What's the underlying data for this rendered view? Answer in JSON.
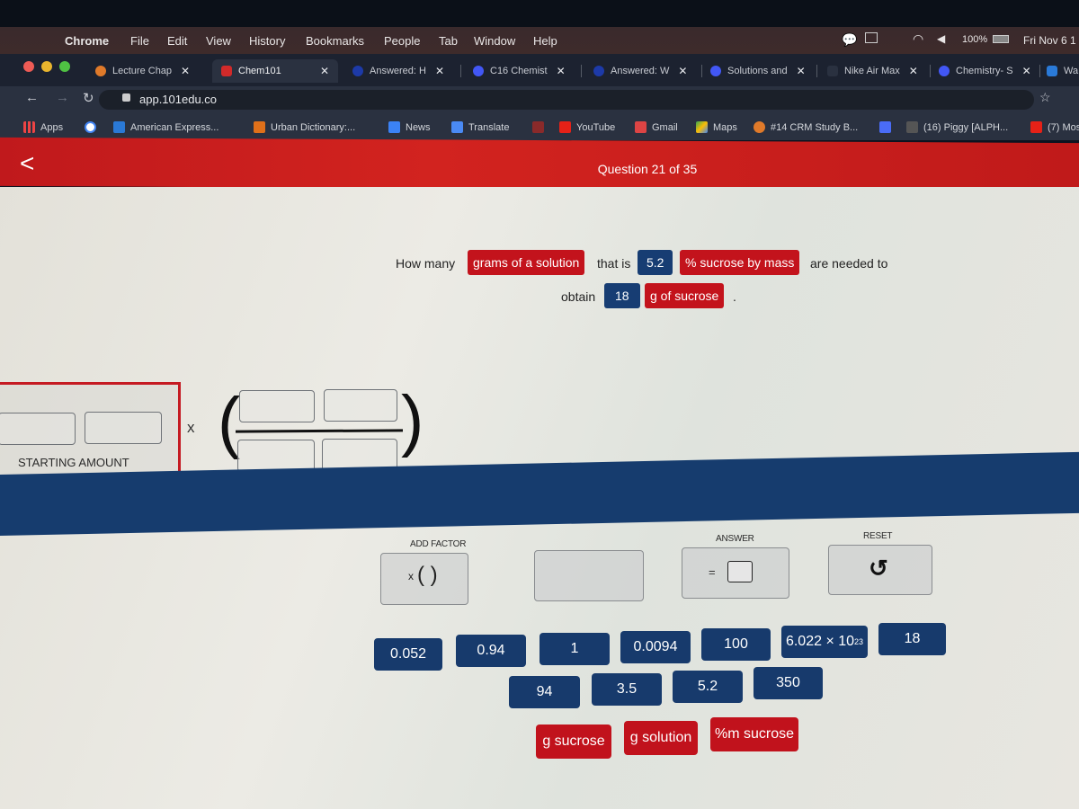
{
  "menubar": {
    "app": "Chrome",
    "items": [
      "File",
      "Edit",
      "View",
      "History",
      "Bookmarks",
      "People",
      "Tab",
      "Window",
      "Help"
    ],
    "battery": "100%",
    "clock": "Fri Nov 6 1"
  },
  "tabs": [
    {
      "label": "Lecture Chap",
      "favicon": "lecture-icon",
      "color": "#e07a2a"
    },
    {
      "label": "Chem101",
      "favicon": "101-icon",
      "color": "#d22a2a",
      "active": true
    },
    {
      "label": "Answered: H",
      "favicon": "bartleby-icon",
      "color": "#1d3aa8"
    },
    {
      "label": "C16 Chemist",
      "favicon": "quizlet-icon",
      "color": "#4257f5"
    },
    {
      "label": "Answered: W",
      "favicon": "bartleby-icon",
      "color": "#1d3aa8"
    },
    {
      "label": "Solutions and",
      "favicon": "quizlet-icon",
      "color": "#4257f5"
    },
    {
      "label": "Nike Air Max",
      "favicon": "nike-icon",
      "color": "#444"
    },
    {
      "label": "Chemistry- S",
      "favicon": "quizlet-icon",
      "color": "#4257f5"
    },
    {
      "label": "Wa",
      "favicon": "bing-icon",
      "color": "#2a7ad8"
    }
  ],
  "address_bar": {
    "url": "app.101edu.co"
  },
  "bookmarks": [
    {
      "label": "Apps",
      "icon": "apps-grid-icon"
    },
    {
      "label": "",
      "icon": "google-icon"
    },
    {
      "label": "American Express...",
      "icon": "amex-icon"
    },
    {
      "label": "Urban Dictionary:...",
      "icon": "urban-dictionary-icon"
    },
    {
      "label": "News",
      "icon": "google-news-icon"
    },
    {
      "label": "Translate",
      "icon": "google-translate-icon"
    },
    {
      "label": "",
      "icon": "bookmark-icon"
    },
    {
      "label": "YouTube",
      "icon": "youtube-icon"
    },
    {
      "label": "Gmail",
      "icon": "gmail-icon"
    },
    {
      "label": "Maps",
      "icon": "maps-icon"
    },
    {
      "label": "#14 CRM Study B...",
      "icon": "lecture-icon"
    },
    {
      "label": "",
      "icon": "docs-icon"
    },
    {
      "label": "(16) Piggy [ALPH...",
      "icon": "roblox-icon"
    },
    {
      "label": "(7) Mos",
      "icon": "youtube-icon"
    }
  ],
  "header": {
    "question_counter": "Question 21 of 35"
  },
  "question": {
    "part1": "How many",
    "chip1": "grams of a solution",
    "part2": "that is",
    "value1": "5.2",
    "chip2": "% sucrose by mass",
    "part3": "are needed to",
    "part4": "obtain",
    "value2": "18",
    "chip3": "g of sucrose",
    "part5": "."
  },
  "equation": {
    "starting_amount_label": "STARTING AMOUNT",
    "times": "x"
  },
  "controls": {
    "add_factor_label": "ADD FACTOR",
    "add_factor_x": "x",
    "add_factor_parens": "(  )",
    "answer_label": "ANSWER",
    "answer_eq": "=",
    "reset_label": "RESET"
  },
  "number_tiles": [
    "0.052",
    "0.94",
    "1",
    "0.0094",
    "100",
    "6.022 × 10",
    "18",
    "94",
    "3.5",
    "5.2",
    "350"
  ],
  "avogadro_exponent": "23",
  "unit_tiles": [
    "g sucrose",
    "g solution",
    "%m sucrose"
  ],
  "colors": {
    "brand_red": "#c3131c",
    "tile_blue": "#173a6c"
  }
}
